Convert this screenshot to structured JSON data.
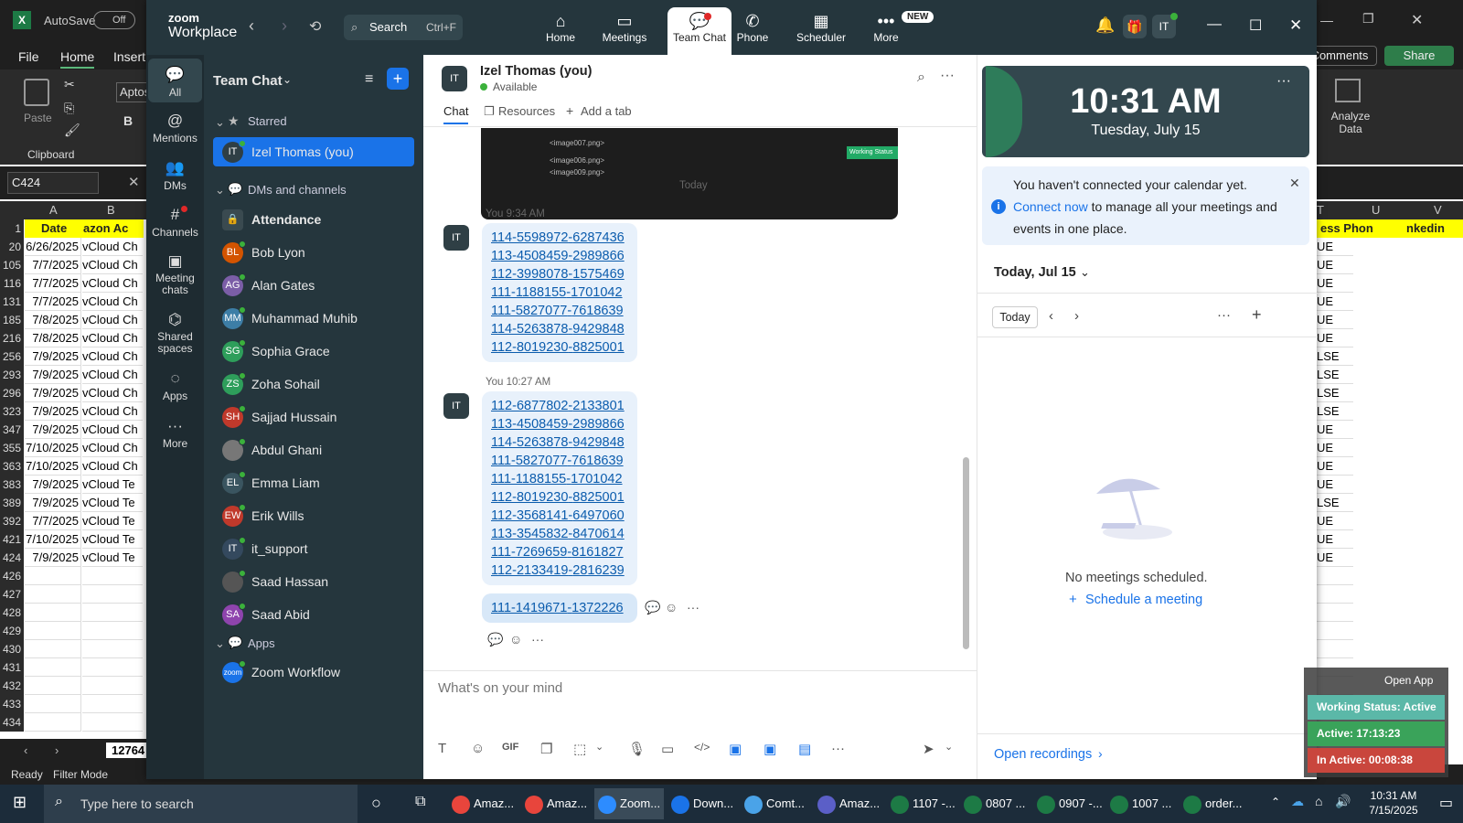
{
  "excel": {
    "autosave": "AutoSave",
    "autosave_state": "Off",
    "menu": [
      "File",
      "Home",
      "Insert"
    ],
    "paste": "Paste",
    "clipboard": "Clipboard",
    "font": "Aptos",
    "bold": "B",
    "namebox": "C424",
    "col_a": "A",
    "col_b": "B",
    "col_t": "T",
    "col_u": "U",
    "col_v": "V",
    "hdr_row": "1",
    "hdr_date": "Date",
    "hdr_amazon": "azon Ac",
    "hdr_ess": "ess",
    "hdr_phon": "ess Phon",
    "hdr_inkedin": "nkedin",
    "rows": [
      {
        "n": "20",
        "a": "6/26/2025",
        "b": "vCloud Ch",
        "r": "UE"
      },
      {
        "n": "105",
        "a": "7/7/2025",
        "b": "vCloud Ch",
        "r": "UE"
      },
      {
        "n": "116",
        "a": "7/7/2025",
        "b": "vCloud Ch",
        "r": "UE"
      },
      {
        "n": "131",
        "a": "7/7/2025",
        "b": "vCloud Ch",
        "r": "UE"
      },
      {
        "n": "185",
        "a": "7/8/2025",
        "b": "vCloud Ch",
        "r": "UE"
      },
      {
        "n": "216",
        "a": "7/8/2025",
        "b": "vCloud Ch",
        "r": "UE"
      },
      {
        "n": "256",
        "a": "7/9/2025",
        "b": "vCloud Ch",
        "r": "LSE"
      },
      {
        "n": "293",
        "a": "7/9/2025",
        "b": "vCloud Ch",
        "r": "LSE"
      },
      {
        "n": "296",
        "a": "7/9/2025",
        "b": "vCloud Ch",
        "r": "LSE"
      },
      {
        "n": "323",
        "a": "7/9/2025",
        "b": "vCloud Ch",
        "r": "LSE"
      },
      {
        "n": "347",
        "a": "7/9/2025",
        "b": "vCloud Ch",
        "r": "UE"
      },
      {
        "n": "355",
        "a": "7/10/2025",
        "b": "vCloud Ch",
        "r": "UE"
      },
      {
        "n": "363",
        "a": "7/10/2025",
        "b": "vCloud Ch",
        "r": "UE"
      },
      {
        "n": "383",
        "a": "7/9/2025",
        "b": "vCloud Te",
        "r": "UE"
      },
      {
        "n": "389",
        "a": "7/9/2025",
        "b": "vCloud Te",
        "r": "LSE"
      },
      {
        "n": "392",
        "a": "7/7/2025",
        "b": "vCloud Te",
        "r": "UE"
      },
      {
        "n": "421",
        "a": "7/10/2025",
        "b": "vCloud Te",
        "r": "UE"
      },
      {
        "n": "424",
        "a": "7/9/2025",
        "b": "vCloud Te",
        "r": "UE"
      },
      {
        "n": "426",
        "a": "",
        "b": "",
        "r": ""
      },
      {
        "n": "427",
        "a": "",
        "b": "",
        "r": ""
      },
      {
        "n": "428",
        "a": "",
        "b": "",
        "r": ""
      },
      {
        "n": "429",
        "a": "",
        "b": "",
        "r": ""
      },
      {
        "n": "430",
        "a": "",
        "b": "",
        "r": ""
      },
      {
        "n": "431",
        "a": "",
        "b": "",
        "r": ""
      },
      {
        "n": "432",
        "a": "",
        "b": "",
        "r": ""
      },
      {
        "n": "433",
        "a": "",
        "b": "",
        "r": ""
      },
      {
        "n": "434",
        "a": "",
        "b": "",
        "r": ""
      }
    ],
    "sheet_tab": "12764",
    "status_ready": "Ready",
    "status_filter": "Filter Mode",
    "comments": "Comments",
    "share": "Share",
    "analyze": "Analyze Data"
  },
  "zoom": {
    "brand_top": "zoom",
    "brand_bottom": "Workplace",
    "search_label": "Search",
    "search_shortcut": "Ctrl+F",
    "nav": [
      {
        "label": "Home",
        "icon": "home-icon"
      },
      {
        "label": "Meetings",
        "icon": "video-icon"
      },
      {
        "label": "Team Chat",
        "icon": "chat-icon"
      },
      {
        "label": "Phone",
        "icon": "phone-icon"
      },
      {
        "label": "Scheduler",
        "icon": "calendar-icon"
      },
      {
        "label": "More",
        "icon": "more-icon"
      }
    ],
    "new_badge": "NEW",
    "user_initials": "IT",
    "rail": [
      "All",
      "Mentions",
      "DMs",
      "Channels",
      "Meeting chats",
      "Shared spaces",
      "Apps",
      "More"
    ],
    "list_title": "Team Chat",
    "starred": "Starred",
    "starred_item": "Izel Thomas (you)",
    "dms_section": "DMs and channels",
    "contacts": [
      {
        "name": "Attendance",
        "initials": "",
        "color": "#3a4a50"
      },
      {
        "name": "Bob Lyon",
        "initials": "BL",
        "color": "#d35400"
      },
      {
        "name": "Alan Gates",
        "initials": "AG",
        "color": "#7b5ea7"
      },
      {
        "name": "Muhammad Muhib",
        "initials": "MM",
        "color": "#3d7ea6"
      },
      {
        "name": "Sophia Grace",
        "initials": "SG",
        "color": "#2e9e5b"
      },
      {
        "name": "Zoha Sohail",
        "initials": "ZS",
        "color": "#2e9e5b"
      },
      {
        "name": "Sajjad Hussain",
        "initials": "SH",
        "color": "#c0392b"
      },
      {
        "name": "Abdul Ghani",
        "initials": "",
        "color": "#777"
      },
      {
        "name": "Emma Liam",
        "initials": "EL",
        "color": "#3a5560"
      },
      {
        "name": "Erik Wills",
        "initials": "EW",
        "color": "#c0392b"
      },
      {
        "name": "it_support",
        "initials": "IT",
        "color": "#34495e"
      },
      {
        "name": "Saad Hassan",
        "initials": "",
        "color": "#555"
      },
      {
        "name": "Saad Abid",
        "initials": "SA",
        "color": "#8e44ad"
      }
    ],
    "apps_section": "Apps",
    "app_item": "Zoom Workflow",
    "chat_name": "Izel Thomas (you)",
    "chat_status": "Available",
    "tabs": [
      "Chat",
      "Resources",
      "Add a tab"
    ],
    "preview_lines": [
      "<image007.png>",
      "<image006.png>",
      "<image009.png>"
    ],
    "preview_badge": "Working Status",
    "today": "Today",
    "msg1_time": "You 9:34 AM",
    "msg1": [
      [
        "114-5598972",
        "6287436"
      ],
      [
        "113-4508459",
        "2989866"
      ],
      [
        "112-3998078",
        "1575469"
      ],
      [
        "111-1188155",
        "1701042"
      ],
      [
        "111-5827077",
        "7618639"
      ],
      [
        "114-5263878",
        "9429848"
      ],
      [
        "112-8019230",
        "8825001"
      ]
    ],
    "msg2_time": "You 10:27 AM",
    "msg2": [
      [
        "112-6877802",
        "2133801"
      ],
      [
        "113-4508459",
        "2989866"
      ],
      [
        "114-5263878",
        "9429848"
      ],
      [
        "111-5827077",
        "7618639"
      ],
      [
        "111-1188155",
        "1701042"
      ],
      [
        "112-8019230",
        "8825001"
      ],
      [
        "112-3568141",
        "6497060"
      ],
      [
        "113-3545832",
        "8470614"
      ],
      [
        "111-7269659",
        "8161827"
      ],
      [
        "112-2133419",
        "2816239"
      ]
    ],
    "msg3": [
      [
        "111-1419671",
        "1372226"
      ]
    ],
    "composer_placeholder": "What's on your mind",
    "clock_time": "10:31 AM",
    "clock_date": "Tuesday, July 15",
    "banner_pre": "You haven't connected your calendar yet. ",
    "banner_link": "Connect now",
    "banner_post": " to manage all your meetings and events in one place.",
    "cal_date": "Today, Jul 15",
    "cal_today_btn": "Today",
    "no_meetings": "No meetings scheduled.",
    "schedule_link": "Schedule a meeting",
    "open_recordings": "Open recordings"
  },
  "widget": {
    "open_app": "Open App",
    "working": "Working Status: Active",
    "active": "Active: 17:13:23",
    "inactive": "In Active: 00:08:38"
  },
  "taskbar": {
    "search": "Type here to search",
    "tasks": [
      "Amaz...",
      "Amaz...",
      "Zoom...",
      "Down...",
      "Comt...",
      "Amaz...",
      "1107 -...",
      "0807 ...",
      "0907 -...",
      "1007 ...",
      "order..."
    ],
    "time": "10:31 AM",
    "date": "7/15/2025"
  }
}
